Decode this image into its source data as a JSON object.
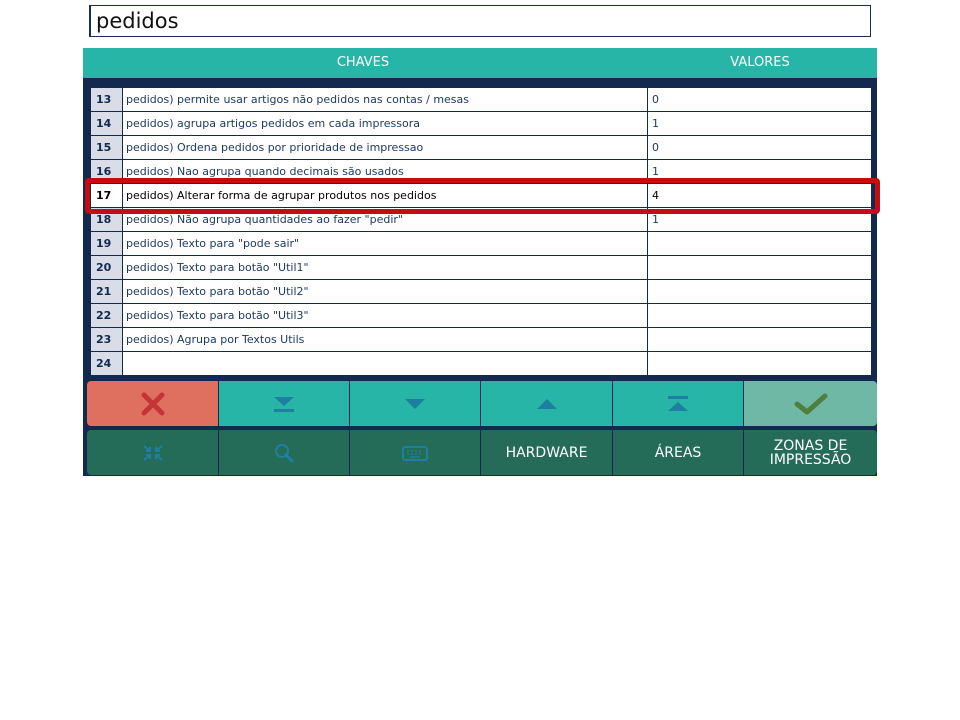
{
  "search": {
    "value": "pedidos"
  },
  "header": {
    "keys_label": "CHAVES",
    "values_label": "VALORES"
  },
  "rows": [
    {
      "num": "13",
      "key": "pedidos) permite usar artigos não pedidos nas contas / mesas",
      "value": "0"
    },
    {
      "num": "14",
      "key": "pedidos) agrupa artigos pedidos em cada impressora",
      "value": "1"
    },
    {
      "num": "15",
      "key": "pedidos) Ordena pedidos por prioridade de impressao",
      "value": "0"
    },
    {
      "num": "16",
      "key": "pedidos) Nao agrupa quando decimais são usados",
      "value": "1"
    },
    {
      "num": "17",
      "key": "pedidos) Alterar forma de agrupar produtos nos pedidos",
      "value": "4"
    },
    {
      "num": "18",
      "key": "pedidos) Não agrupa quantidades ao fazer \"pedir\"",
      "value": "1"
    },
    {
      "num": "19",
      "key": "pedidos) Texto para \"pode sair\"",
      "value": ""
    },
    {
      "num": "20",
      "key": "pedidos) Texto para botão \"Util1\"",
      "value": ""
    },
    {
      "num": "21",
      "key": "pedidos) Texto para botão \"Util2\"",
      "value": ""
    },
    {
      "num": "22",
      "key": "pedidos) Texto para botão \"Util3\"",
      "value": ""
    },
    {
      "num": "23",
      "key": "pedidos) Agrupa por Textos Utils",
      "value": ""
    },
    {
      "num": "24",
      "key": "",
      "value": ""
    }
  ],
  "selected_row": "17",
  "nav_buttons": {
    "cancel_icon": "close-icon",
    "last_icon": "chevron-double-down-icon",
    "down_icon": "triangle-down-icon",
    "up_icon": "triangle-up-icon",
    "first_icon": "chevron-double-up-icon",
    "confirm_icon": "check-icon"
  },
  "bottom_buttons": {
    "collapse_icon": "collapse-icon",
    "search_icon": "search-icon",
    "keyboard_icon": "keyboard-icon",
    "hardware": "HARDWARE",
    "areas": "ÁREAS",
    "zones": "ZONAS DE IMPRESSÃO"
  },
  "colors": {
    "teal": "#27b5a7",
    "navy": "#13294f",
    "cancel": "#df7060",
    "confirm": "#6fb8a5",
    "dark_green": "#246b58",
    "highlight": "#c60b12"
  }
}
